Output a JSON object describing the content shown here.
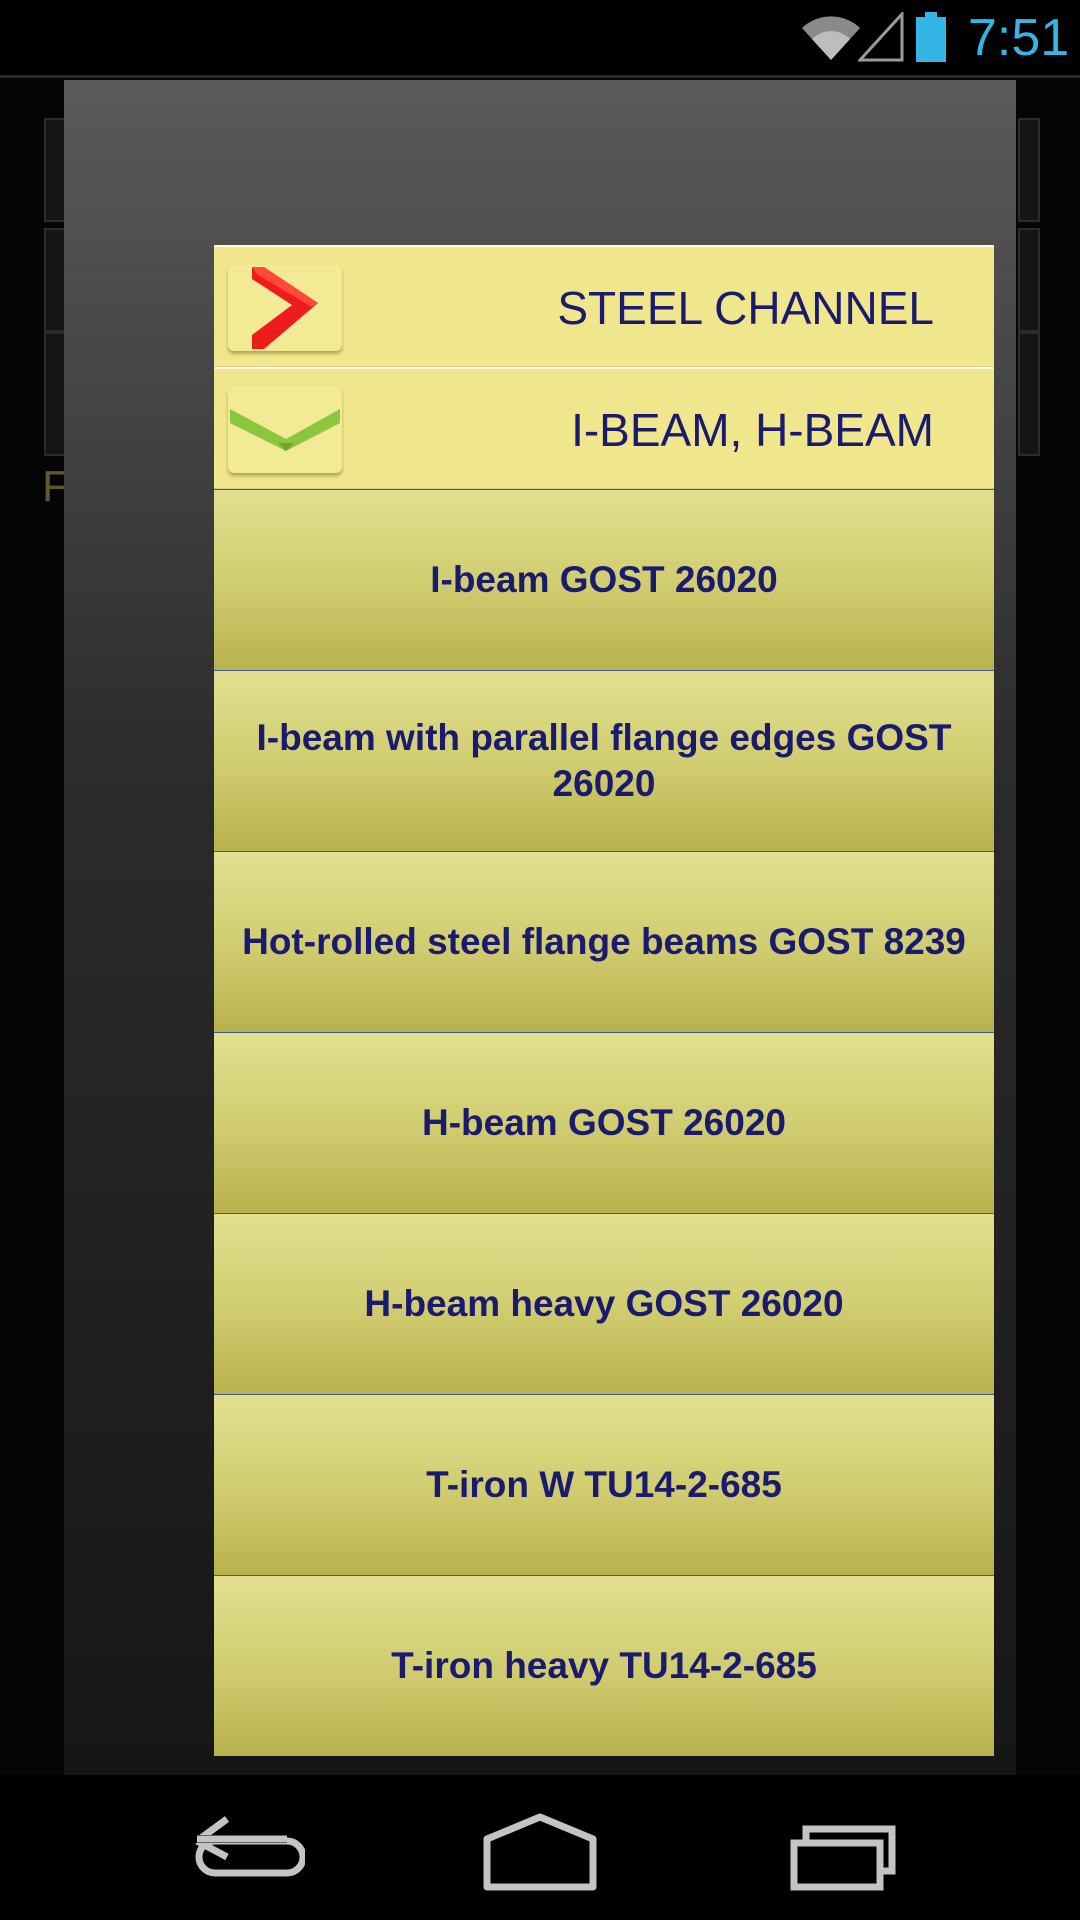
{
  "status_bar": {
    "time": "7:51",
    "icons": [
      "wifi-icon",
      "cell-signal-icon",
      "battery-icon"
    ],
    "time_color": "#33b5e5"
  },
  "background_app": {
    "visible_letter": "F"
  },
  "dialog": {
    "headers": [
      {
        "label": "STEEL CHANNEL",
        "icon": "chevron-right-icon",
        "icon_color": "#ee1c1c",
        "expanded": false
      },
      {
        "label": "I-BEAM, H-BEAM",
        "icon": "chevron-down-icon",
        "icon_color": "#8cc63f",
        "expanded": true
      }
    ],
    "items": [
      {
        "label": "I-beam GOST 26020"
      },
      {
        "label": "I-beam with parallel flange edges GOST 26020"
      },
      {
        "label": "Hot-rolled steel flange beams GOST 8239"
      },
      {
        "label": "H-beam GOST 26020"
      },
      {
        "label": "H-beam heavy GOST 26020"
      },
      {
        "label": "T-iron W TU14-2-685"
      },
      {
        "label": "T-iron heavy TU14-2-685"
      }
    ],
    "colors": {
      "header_bg": "#f0e68c",
      "item_gradient": [
        "#e2e090",
        "#b8b24e"
      ],
      "text": "#1a1a6e"
    }
  },
  "nav_bar": {
    "buttons": [
      "back-icon",
      "home-icon",
      "recents-icon"
    ]
  }
}
